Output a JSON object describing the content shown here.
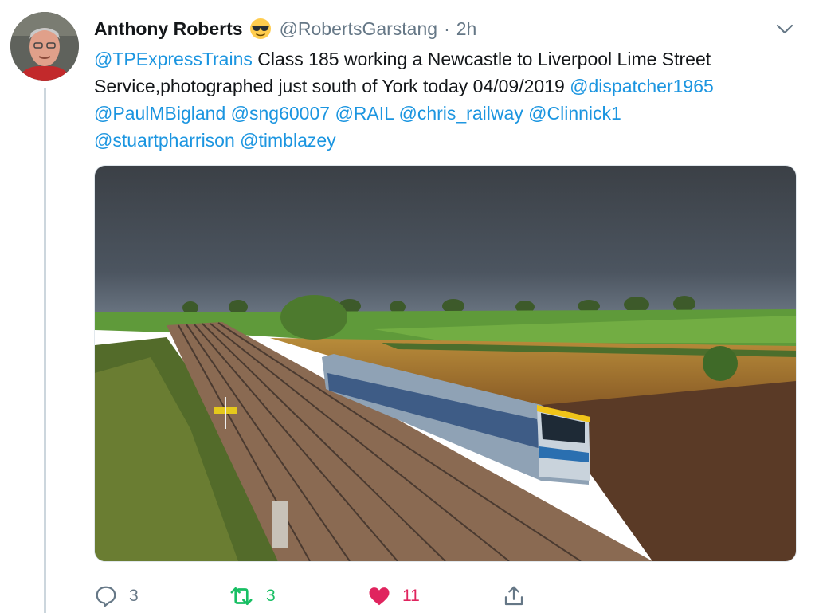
{
  "tweet": {
    "author_name": "Anthony Roberts",
    "handle": "@RobertsGarstang",
    "separator": "·",
    "time": "2h",
    "text": {
      "mention_trains": "@TPExpressTrains",
      "text_part1": " Class 185 working a Newcastle to Liverpool Lime Street",
      "text_part2": "Service,photographed just south of York today 04/09/2019 ",
      "mention_dispatcher": "@dispatcher1965",
      "mention_paul": "@PaulMBigland",
      "mention_sng": "@sng60007",
      "mention_rail": "@RAIL",
      "mention_chris": "@chris_railway",
      "mention_clinnick": "@Clinnick1",
      "mention_stuart": "@stuartpharrison",
      "mention_tim": "@timblazey"
    }
  },
  "actions": {
    "reply_count": "3",
    "retweet_count": "3",
    "like_count": "11"
  },
  "icons": [
    "sunglasses-emoji",
    "chevron-down-icon",
    "reply-icon",
    "retweet-icon",
    "heart-icon",
    "share-icon"
  ],
  "colors": {
    "link": "#1b95e0",
    "secondary_text": "#657786",
    "retweet_active": "#17bf63",
    "like_active": "#e0245e"
  }
}
